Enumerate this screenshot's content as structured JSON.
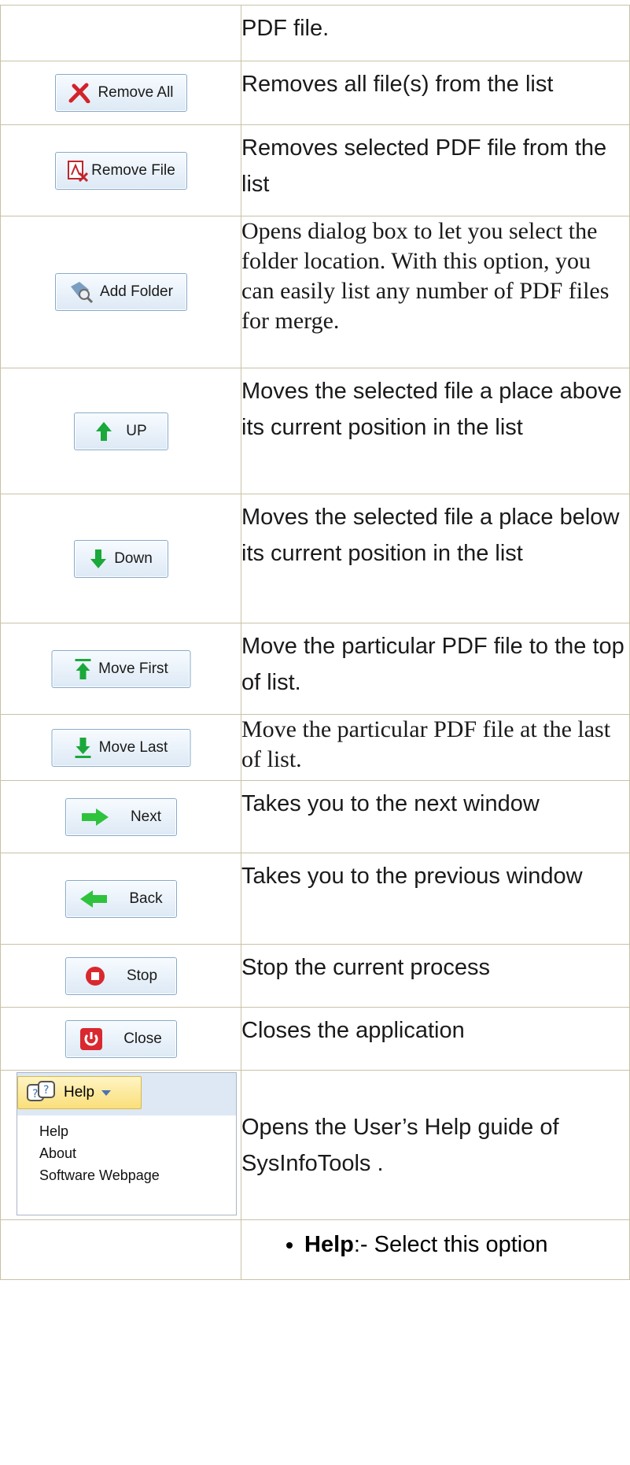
{
  "rows": [
    {
      "button": "",
      "text": "PDF file."
    },
    {
      "button": "Remove All",
      "text": "Removes all file(s) from the list"
    },
    {
      "button": "Remove File",
      "text": "Removes selected PDF file from the list"
    },
    {
      "button": "Add Folder",
      "text": "Opens dialog box to let you select the folder location. With this option, you can easily list any number of PDF files for merge."
    },
    {
      "button": "UP",
      "text": "Moves the selected file a place above its current position in the list"
    },
    {
      "button": "Down",
      "text": "Moves the selected file a place below its current position in the list"
    },
    {
      "button": "Move First",
      "text": "Move the particular PDF file to the top of list."
    },
    {
      "button": "Move Last",
      "text": "Move the particular PDF file at the last of list."
    },
    {
      "button": "Next",
      "text": "Takes you to the next window"
    },
    {
      "button": "Back",
      "text": "Takes you to the previous window"
    },
    {
      "button": "Stop",
      "text": "Stop the current process"
    },
    {
      "button": "Close",
      "text": "Closes the application"
    }
  ],
  "help_row": {
    "button": "Help",
    "menu_items": [
      "Help",
      "About",
      "Software Webpage"
    ],
    "text": "Opens the User’s Help guide of SysInfoTools ."
  },
  "last_row": {
    "bullet_bold": "Help",
    "bullet_text": ":- Select this option"
  }
}
